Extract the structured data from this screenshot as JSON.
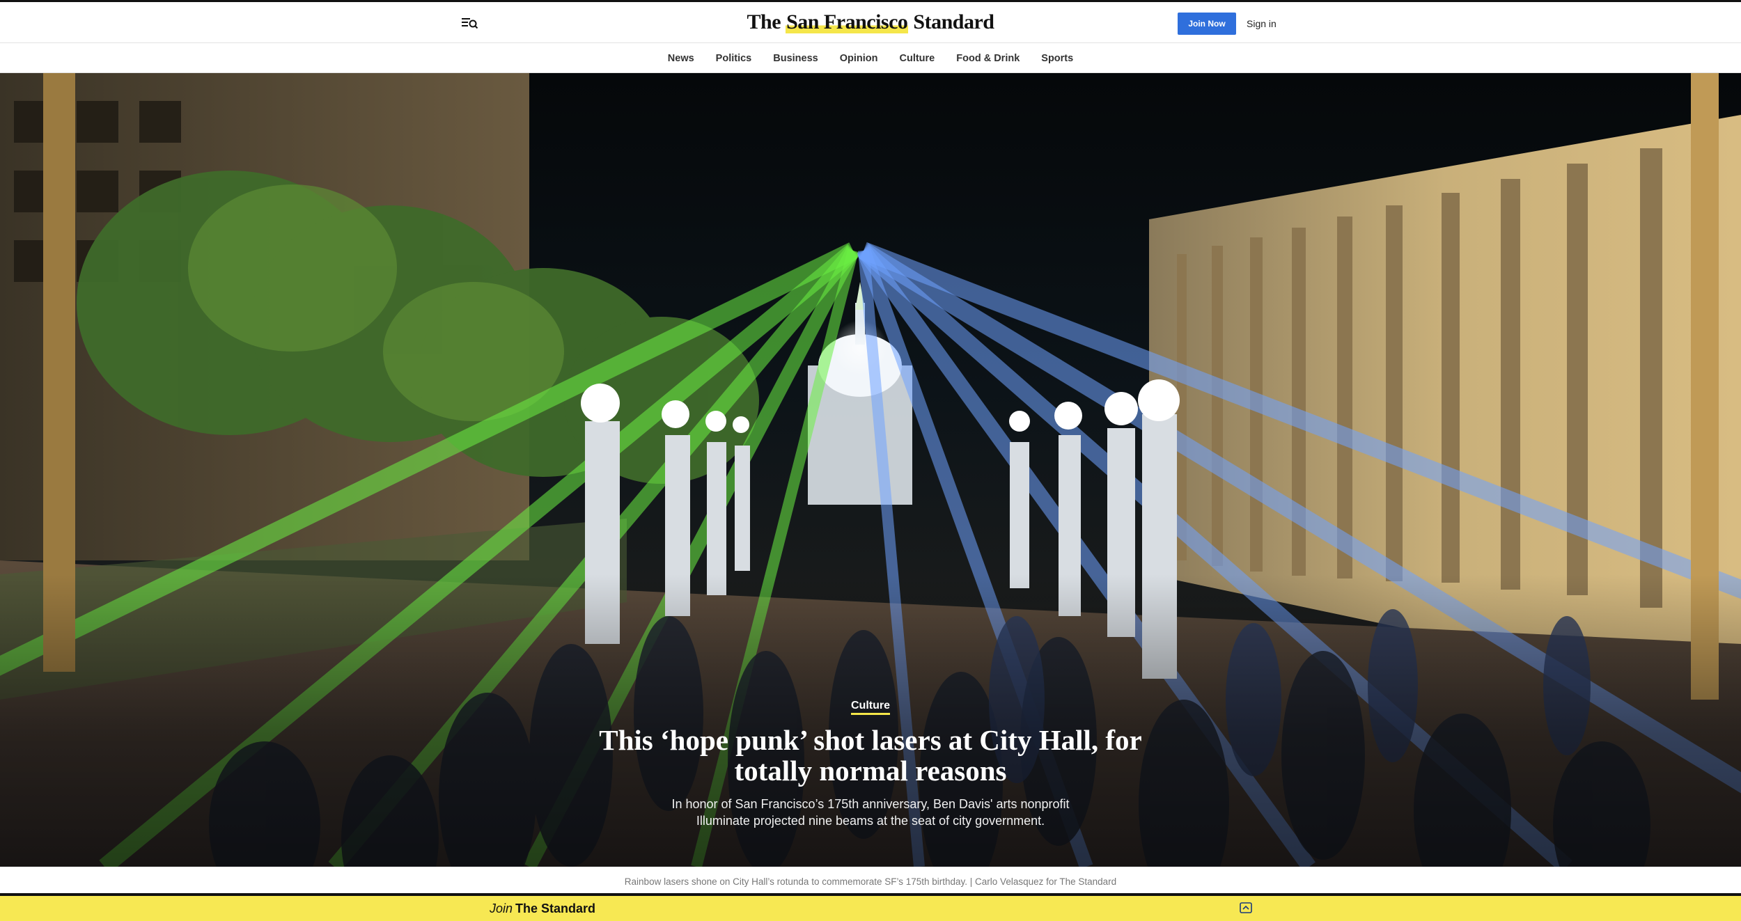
{
  "header": {
    "logo_prefix": "The ",
    "logo_highlight": "San Francisco",
    "logo_suffix": " Standard",
    "join_label": "Join Now",
    "signin_label": "Sign in",
    "menu_icon": "menu-search-icon",
    "brand_color": "#2f6fdc",
    "highlight_color": "#f5e64a"
  },
  "nav": {
    "items": [
      "News",
      "Politics",
      "Business",
      "Opinion",
      "Culture",
      "Food & Drink",
      "Sports"
    ]
  },
  "hero": {
    "kicker": "Culture",
    "headline": "This ‘hope punk’ shot lasers at City Hall, for totally normal reasons",
    "dek": "In honor of San Francisco’s 175th anniversary, Ben Davis' arts nonprofit Illuminate projected nine beams at the seat of city government."
  },
  "caption": "Rainbow lasers shone on City Hall’s rotunda to commemorate SF’s 175th birthday. | Carlo Velasquez for The Standard",
  "joinbar": {
    "join_word": "Join",
    "brand": "The Standard",
    "expand_icon": "chevron-up-icon",
    "bar_color": "#f7e853"
  }
}
